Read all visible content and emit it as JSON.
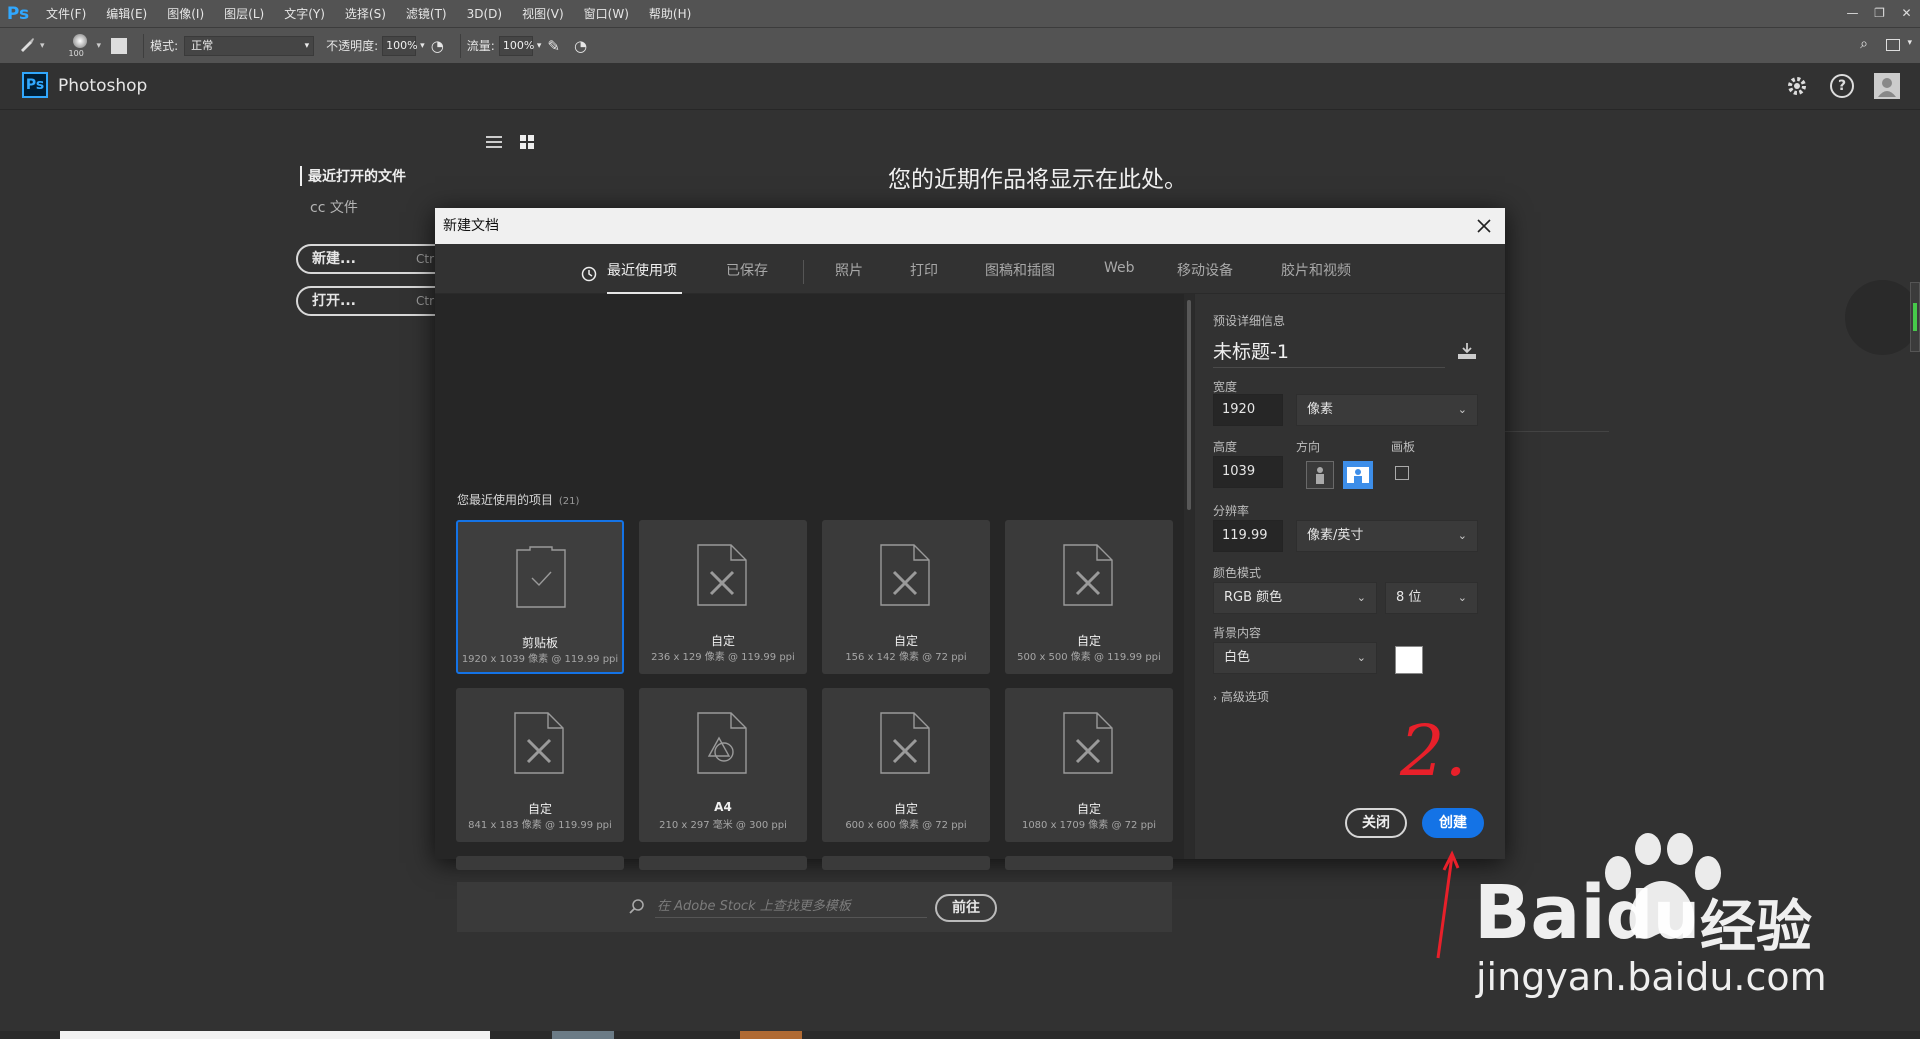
{
  "menubar": {
    "logo": "Ps",
    "items": [
      "文件(F)",
      "编辑(E)",
      "图像(I)",
      "图层(L)",
      "文字(Y)",
      "选择(S)",
      "滤镜(T)",
      "3D(D)",
      "视图(V)",
      "窗口(W)",
      "帮助(H)"
    ],
    "window_controls": [
      "—",
      "❐",
      "✕"
    ]
  },
  "optbar": {
    "brush_size": "100",
    "mode_label": "模式:",
    "mode_value": "正常",
    "opacity_label": "不透明度:",
    "opacity_value": "100%",
    "flow_label": "流量:",
    "flow_value": "100%"
  },
  "home": {
    "app_badge": "Ps",
    "app_name": "Photoshop",
    "recent_files": "最近打开的文件",
    "cc_files": "cc 文件",
    "new_button": "新建...",
    "new_shortcut": "Ctr",
    "open_button": "打开...",
    "open_shortcut": "Ctr",
    "empty_message": "您的近期作品将显示在此处。"
  },
  "dialog": {
    "title": "新建文档",
    "tabs": [
      {
        "label": "最近使用项",
        "active": true
      },
      {
        "label": "已保存",
        "active": false
      },
      {
        "label": "照片",
        "active": false
      },
      {
        "label": "打印",
        "active": false
      },
      {
        "label": "图稿和插图",
        "active": false
      },
      {
        "label": "Web",
        "active": false
      },
      {
        "label": "移动设备",
        "active": false
      },
      {
        "label": "胶片和视频",
        "active": false
      }
    ],
    "recent_title": "您最近使用的项目",
    "recent_count": "(21)",
    "presets": [
      {
        "name": "剪贴板",
        "meta": "1920 x 1039 像素 @ 119.99 ppi",
        "icon": "clipboard"
      },
      {
        "name": "自定",
        "meta": "236 x 129 像素 @ 119.99 ppi",
        "icon": "custom"
      },
      {
        "name": "自定",
        "meta": "156 x 142 像素 @ 72 ppi",
        "icon": "custom"
      },
      {
        "name": "自定",
        "meta": "500 x 500 像素 @ 119.99 ppi",
        "icon": "custom"
      },
      {
        "name": "自定",
        "meta": "841 x 183 像素 @ 119.99 ppi",
        "icon": "custom"
      },
      {
        "name": "A4",
        "meta": "210 x 297 毫米 @ 300 ppi",
        "icon": "print"
      },
      {
        "name": "自定",
        "meta": "600 x 600 像素 @ 72 ppi",
        "icon": "custom"
      },
      {
        "name": "自定",
        "meta": "1080 x 1709 像素 @ 72 ppi",
        "icon": "custom"
      }
    ],
    "search_placeholder": "在 Adobe Stock 上查找更多模板",
    "go_button": "前往",
    "details": {
      "section_label": "预设详细信息",
      "doc_name": "未标题-1",
      "width_label": "宽度",
      "width_value": "1920",
      "width_unit": "像素",
      "height_label": "高度",
      "height_value": "1039",
      "orientation_label": "方向",
      "artboard_label": "画板",
      "resolution_label": "分辨率",
      "resolution_value": "119.99",
      "resolution_unit": "像素/英寸",
      "color_mode_label": "颜色模式",
      "color_mode_value": "RGB 颜色",
      "bit_depth": "8 位",
      "background_label": "背景内容",
      "background_value": "白色",
      "background_color": "#ffffff",
      "advanced": "高级选项",
      "close_button": "关闭",
      "create_button": "创建"
    }
  },
  "annotation": {
    "step_number": "2.",
    "color": "#e8202a"
  },
  "watermark": {
    "brand": "Bai",
    "brand2": "du",
    "cn": "经验",
    "url": "jingyan.baidu.com"
  },
  "colors": {
    "accent": "#1473e6",
    "ps_blue": "#31a8ff"
  }
}
